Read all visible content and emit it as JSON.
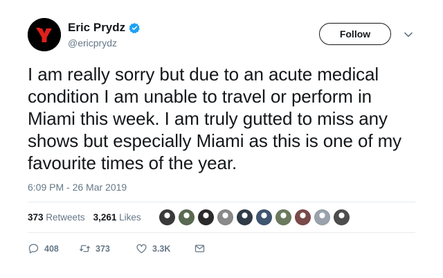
{
  "author": {
    "display_name": "Eric Prydz",
    "handle": "@ericprydz",
    "avatar_icon": "prydz-logo-icon",
    "verified_icon": "verified-badge-icon"
  },
  "header": {
    "follow_label": "Follow",
    "menu_icon": "chevron-down-icon"
  },
  "tweet": {
    "text": "I am really sorry but due to an acute medical condition I am unable to travel or perform in Miami this week. I am truly gutted to miss any shows but especially Miami as this is one of my favourite times of the year.",
    "timestamp": "6:09 PM - 26 Mar 2019"
  },
  "stats": {
    "retweets_count": "373",
    "retweets_label": "Retweets",
    "likes_count": "3,261",
    "likes_label": "Likes"
  },
  "likers": {
    "avatar_colors": [
      "#3a3a3a",
      "#5a6a52",
      "#2b2b2b",
      "#8a8a8a",
      "#2f3b46",
      "#3f5570",
      "#6b7a5e",
      "#7a4a4a",
      "#9aa3ab",
      "#4d4d4d"
    ]
  },
  "actions": {
    "reply_count": "408",
    "retweet_count": "373",
    "like_count": "3.3K"
  },
  "colors": {
    "text": "#14171a",
    "muted": "#657786",
    "verified": "#1da1f2",
    "logo_red": "#e0201b"
  }
}
